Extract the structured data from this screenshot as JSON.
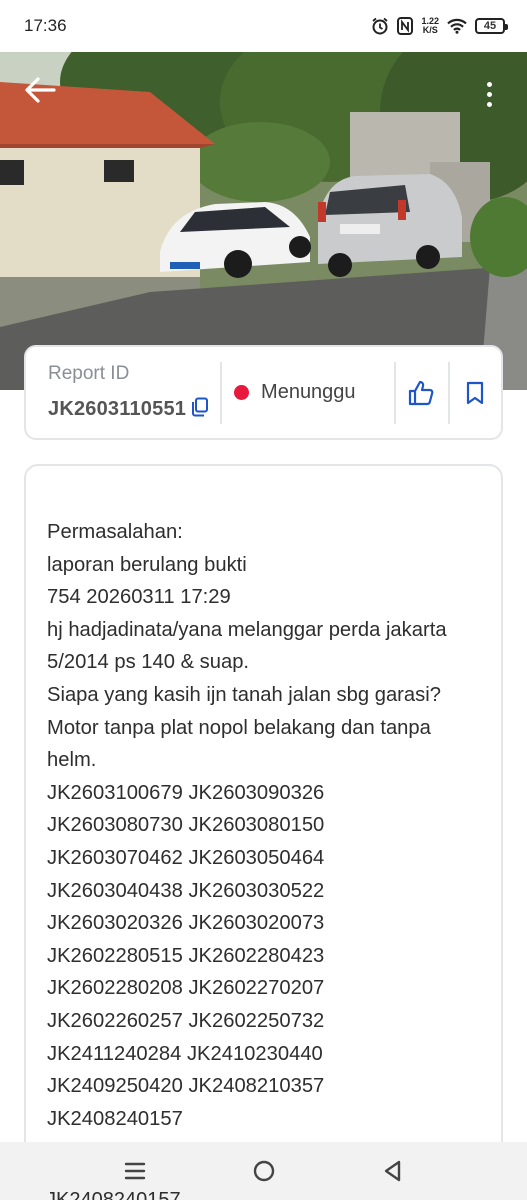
{
  "status_bar": {
    "time": "17:36",
    "speed_value": "1.22",
    "speed_unit": "K/S",
    "battery": "45"
  },
  "report": {
    "id_label": "Report ID",
    "id_value": "JK2603110551",
    "status": "Menunggu",
    "status_color": "#e8193c",
    "accent_color": "#1e56c7"
  },
  "problem": {
    "text": "Permasalahan:\nlaporan berulang bukti\n754 20260311 17:29\nhj hadjadinata/yana melanggar perda jakarta 5/2014 ps 140 & suap.\nSiapa yang kasih ijn tanah jalan sbg garasi?\nMotor tanpa plat nopol belakang dan tanpa helm.\nJK2603100679 JK2603090326\nJK2603080730 JK2603080150\nJK2603070462 JK2603050464\nJK2603040438 JK2603030522\nJK2603020326 JK2603020073\nJK2602280515 JK2602280423\nJK2602280208 JK2602270207\nJK2602260257 JK2602250732\nJK2411240284 JK2410230440\nJK2409250420 JK2408210357\nJK2408240157",
    "peek_text": "JK2408240157"
  },
  "icons": {
    "back": "arrow-left-icon",
    "more": "more-vertical-icon",
    "copy": "copy-icon",
    "like": "thumbs-up-icon",
    "bookmark": "bookmark-icon",
    "nav_menu": "menu-icon",
    "nav_home": "home-circle-icon",
    "nav_back": "back-triangle-icon"
  }
}
